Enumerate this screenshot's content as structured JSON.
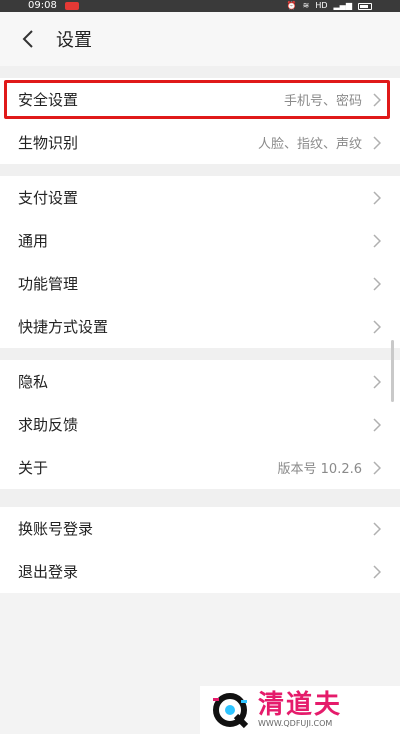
{
  "status_bar": {
    "time": "09:08",
    "network": "HD"
  },
  "header": {
    "title": "设置"
  },
  "groups": [
    {
      "items": [
        {
          "label": "安全设置",
          "value": "手机号、密码"
        },
        {
          "label": "生物识别",
          "value": "人脸、指纹、声纹"
        }
      ]
    },
    {
      "items": [
        {
          "label": "支付设置",
          "value": ""
        },
        {
          "label": "通用",
          "value": ""
        },
        {
          "label": "功能管理",
          "value": ""
        },
        {
          "label": "快捷方式设置",
          "value": ""
        }
      ]
    },
    {
      "items": [
        {
          "label": "隐私",
          "value": ""
        },
        {
          "label": "求助反馈",
          "value": ""
        },
        {
          "label": "关于",
          "value": "版本号 10.2.6"
        }
      ]
    },
    {
      "items": [
        {
          "label": "换账号登录",
          "value": ""
        },
        {
          "label": "退出登录",
          "value": ""
        }
      ]
    }
  ],
  "watermark": {
    "title": "清道夫",
    "url": "WWW.QDFUJI.COM"
  },
  "colors": {
    "highlight": "#e01919",
    "watermark": "#e51b6b"
  }
}
